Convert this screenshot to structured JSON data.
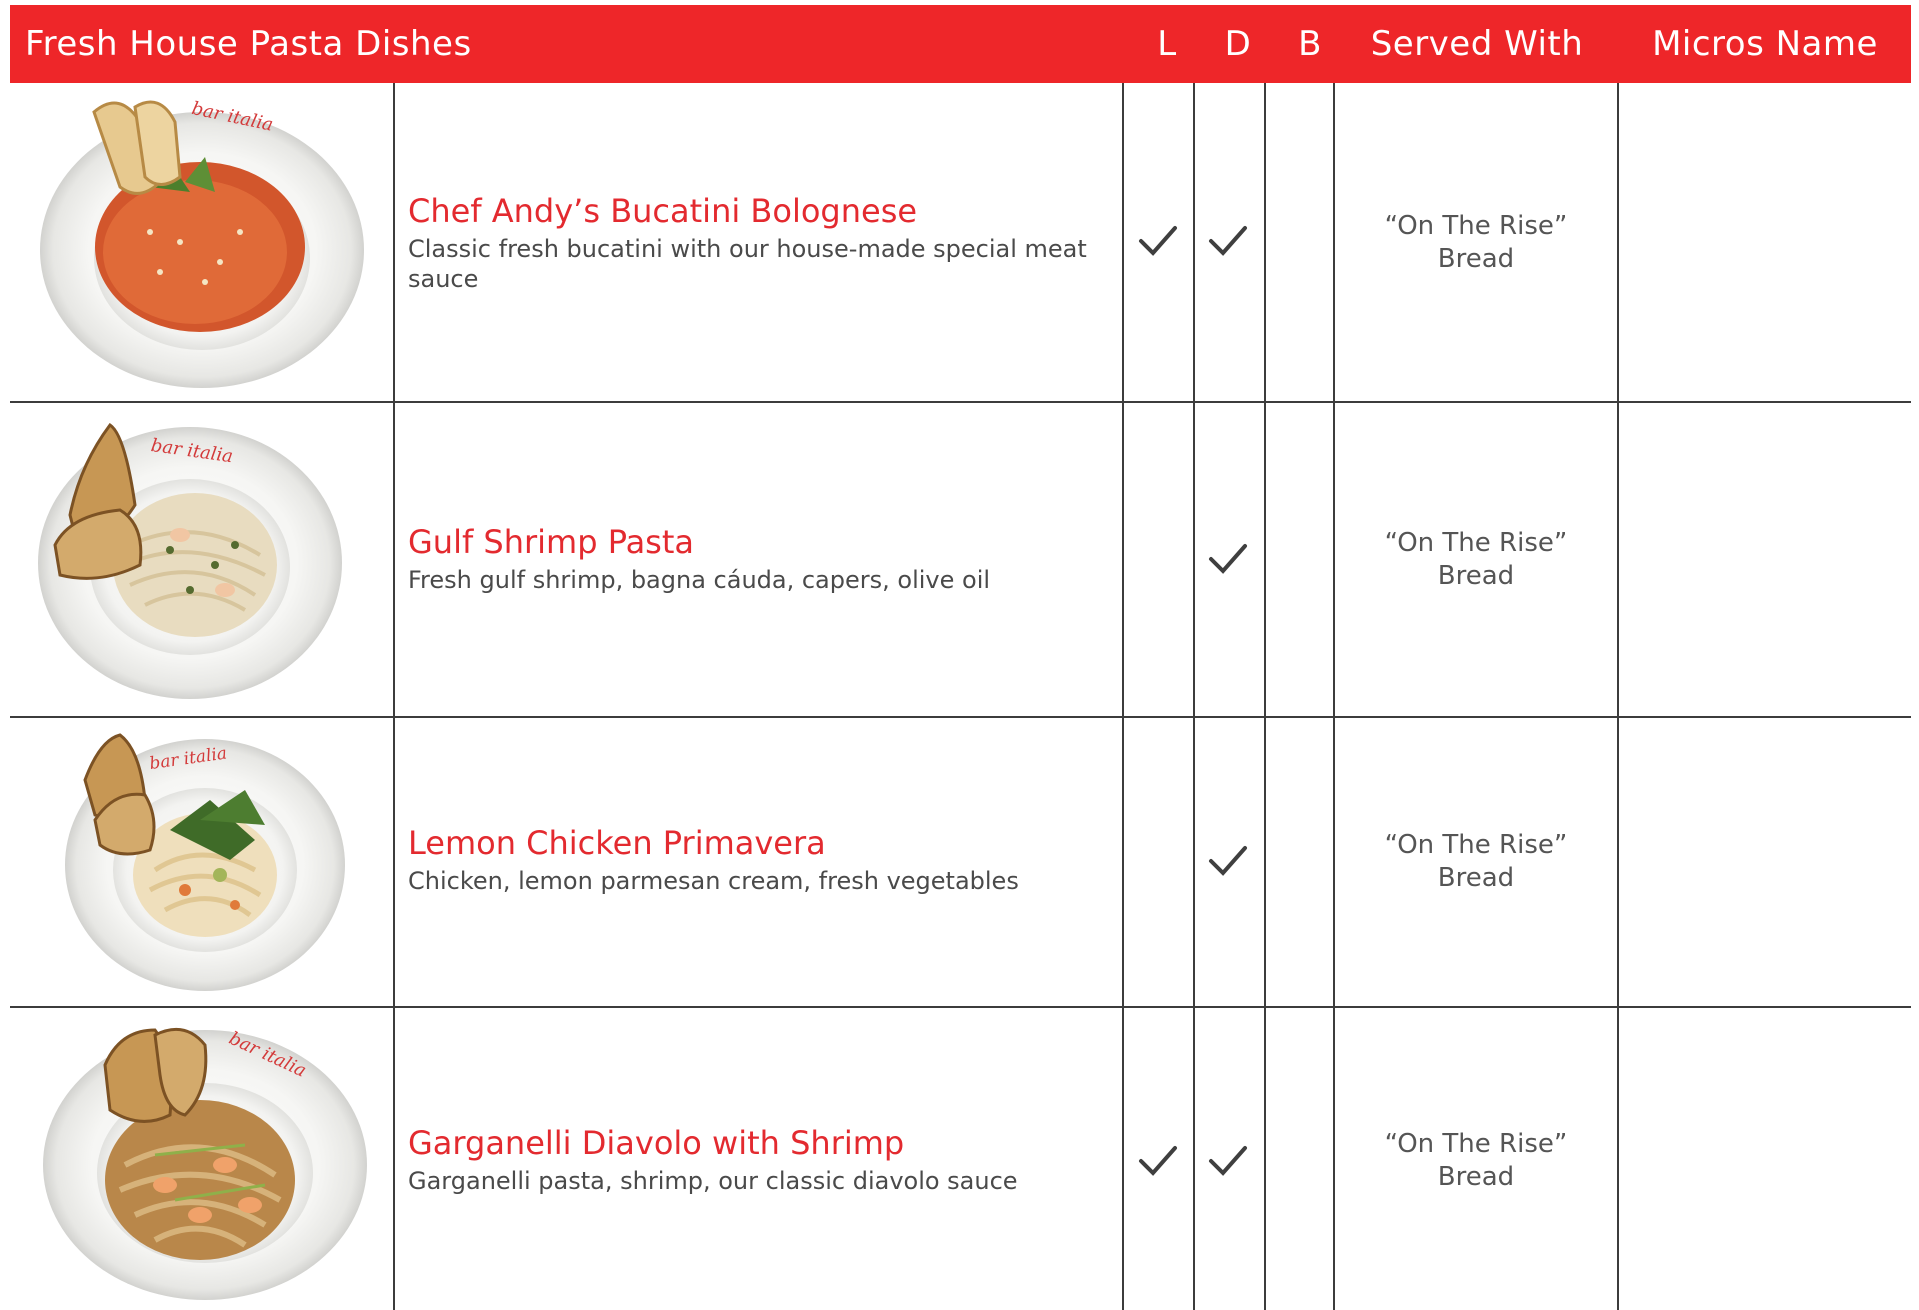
{
  "header": {
    "title": "Fresh House Pasta Dishes",
    "col_l": "L",
    "col_d": "D",
    "col_b": "B",
    "col_served": "Served With",
    "col_micros": "Micros Name"
  },
  "colors": {
    "header_bg": "#ee2629",
    "dish_name": "#e32a2f",
    "body_text": "#4a4a4a",
    "rule": "#3c3c3c"
  },
  "plate_text": "bar italia",
  "dishes": [
    {
      "name": "Chef Andy’s Bucatini Bolognese",
      "description": "Classic fresh bucatini with our house-made special meat sauce",
      "lunch": true,
      "dinner": true,
      "brunch": false,
      "served_line1": "“On The Rise”",
      "served_line2": "Bread",
      "micros_name": ""
    },
    {
      "name": "Gulf Shrimp Pasta",
      "description": "Fresh gulf shrimp, bagna cáuda, capers, olive oil",
      "lunch": false,
      "dinner": true,
      "brunch": false,
      "served_line1": "“On The Rise”",
      "served_line2": "Bread",
      "micros_name": ""
    },
    {
      "name": "Lemon Chicken Primavera",
      "description": "Chicken, lemon parmesan cream, fresh vegetables",
      "lunch": false,
      "dinner": true,
      "brunch": false,
      "served_line1": "“On The Rise”",
      "served_line2": "Bread",
      "micros_name": ""
    },
    {
      "name": "Garganelli Diavolo with Shrimp",
      "description": "Garganelli pasta, shrimp, our classic diavolo sauce",
      "lunch": true,
      "dinner": true,
      "brunch": false,
      "served_line1": "“On The Rise”",
      "served_line2": "Bread",
      "micros_name": ""
    }
  ]
}
